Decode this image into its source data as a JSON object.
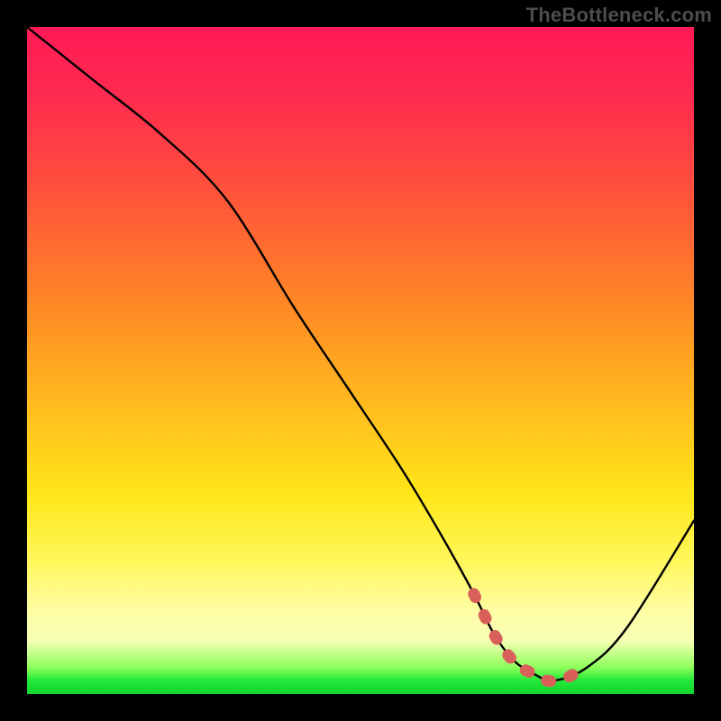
{
  "watermark": "TheBottleneck.com",
  "chart_data": {
    "type": "line",
    "title": "",
    "xlabel": "",
    "ylabel": "",
    "xlim": [
      0,
      100
    ],
    "ylim": [
      0,
      100
    ],
    "grid": false,
    "legend": false,
    "annotations": [],
    "series": [
      {
        "name": "curve",
        "color": "#000000",
        "x": [
          0,
          10,
          20,
          30,
          40,
          48,
          56,
          62,
          67,
          70,
          73,
          76,
          79,
          84,
          90,
          100
        ],
        "values": [
          100,
          92,
          84,
          74,
          58,
          46,
          34,
          24,
          15,
          9,
          5,
          3,
          2,
          4,
          10,
          26
        ]
      },
      {
        "name": "dotted-segment",
        "color": "#d9605a",
        "style": "dashed",
        "x": [
          67,
          70,
          72,
          74,
          76,
          78,
          80,
          82
        ],
        "values": [
          15,
          9,
          6,
          4,
          3,
          2,
          2,
          3
        ]
      }
    ],
    "background_gradient": {
      "stops": [
        {
          "pos": 0.0,
          "hex": "#ff1a55"
        },
        {
          "pos": 0.22,
          "hex": "#ff4a3f"
        },
        {
          "pos": 0.46,
          "hex": "#ff9722"
        },
        {
          "pos": 0.7,
          "hex": "#ffe619"
        },
        {
          "pos": 0.9,
          "hex": "#fffea8"
        },
        {
          "pos": 0.97,
          "hex": "#20e838"
        },
        {
          "pos": 1.0,
          "hex": "#14d62e"
        }
      ]
    }
  }
}
